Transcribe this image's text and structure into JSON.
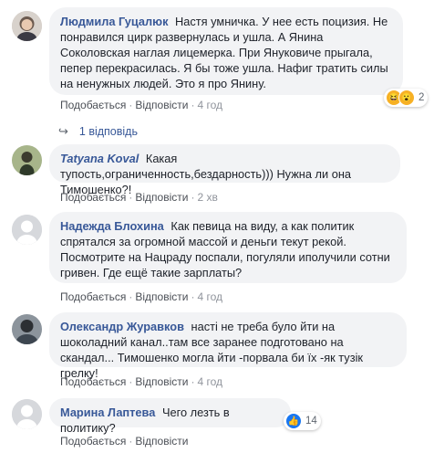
{
  "comments": [
    {
      "author": "Людмила Гуцалюк",
      "text": "Настя умничка. У нее есть поцизия. Не понравился цирк развернулась и ушла. А Янина Соколовская наглая лицемерка. При Януковиче прыгала, пепер перекрасилась. Я бы тоже ушла. Нафиг тратить силы на ненужных людей. Это я про Янину.",
      "like": "Подобається",
      "reply": "Відповісти",
      "time": "4 год",
      "reaction_count": "2",
      "reaction_icons": [
        "laugh-emoji",
        "wow-emoji"
      ],
      "replies_label": "1 відповідь"
    },
    {
      "author": "Tatyana Koval",
      "text": "Какая тупость,ограниченность,бездарность))) Нужна ли она Тимошенко?!",
      "like": "Подобається",
      "reply": "Відповісти",
      "time": "2 хв"
    },
    {
      "author": "Надежда Блохина",
      "text": "Как певица на виду, а как политик спрятался за огромной массой и деньги текут рекой. Посмотрите на Нацраду поспали, погуляли иполучили сотни гривен. Где ещё такие зарплаты?",
      "like": "Подобається",
      "reply": "Відповісти",
      "time": "4 год"
    },
    {
      "author": "Олександр Журавков",
      "text": "насті не треба було йти на шоколадний канал..там все заранее подготовано на скандал... Тимошенко могла йти -порвала би їх -як тузік грелку!",
      "like": "Подобається",
      "reply": "Відповісти",
      "time": "4 год"
    },
    {
      "author": "Марина Лаптева",
      "text": "Чего лезть в политику?",
      "like": "Подобається",
      "reply": "Відповісти",
      "time": "",
      "reaction_count": "14",
      "reaction_icons": [
        "like-icon"
      ]
    }
  ],
  "separator": "·",
  "colors": {
    "author": "#385898",
    "bubble": "#f2f3f5",
    "meta": "#90949c"
  }
}
